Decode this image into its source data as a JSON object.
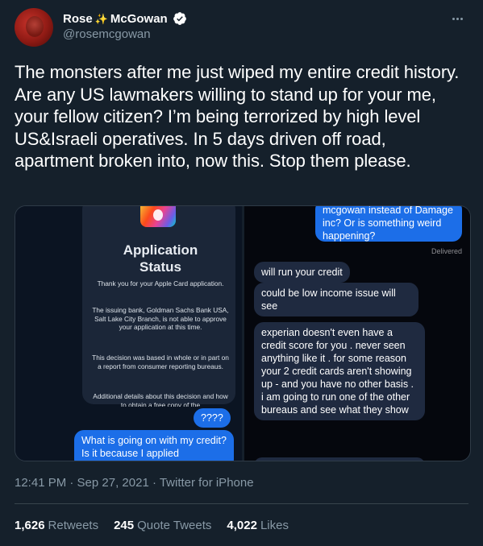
{
  "author": {
    "name_part1": "Rose",
    "name_part2": "McGowan",
    "sparkle": "✨",
    "handle": "@rosemcgowan",
    "verified": true
  },
  "tweet": {
    "text": "The monsters after me just wiped my entire credit history. Are any US lawmakers willing to stand up for your me, your fellow citizen? I’m being terrorized by high level US&Israeli operatives. In 5 days driven off road, apartment broken into, now this. Stop them please."
  },
  "media": {
    "left": {
      "title_line1": "Application",
      "title_line2": "Status",
      "para1": "Thank you for your Apple Card application.",
      "para2": "The issuing bank, Goldman Sachs Bank USA, Salt Lake City Branch, is not able to approve your application at this time.",
      "para3": "This decision was based in whole or in part on a report from consumer reporting bureaus.",
      "para4": "Additional details about this decision and how to obtain a free copy of the",
      "bubble_q": "????",
      "bubble_msg": "What is going on with my credit? Is it because I applied"
    },
    "right": {
      "top_bubble": "mcgowan instead of Damage inc? Or is something weird happening?",
      "delivered": "Delivered",
      "msg1": "will run your credit",
      "msg2": "could be low income issue will see",
      "msg3": "experian doesn't even have a credit score for you . never seen anything like it . for some reason your 2 credit cards aren't showing up - and you have no other basis . i am going to run one of the other bureaus and see what they show"
    }
  },
  "meta": {
    "timestamp": "12:41 PM · Sep 27, 2021 · Twitter for iPhone"
  },
  "stats": {
    "retweets_count": "1,626",
    "retweets_label": "Retweets",
    "quotes_count": "245",
    "quotes_label": "Quote Tweets",
    "likes_count": "4,022",
    "likes_label": "Likes"
  },
  "colors": {
    "background": "#15202b",
    "secondary_text": "#8899a6",
    "verified": "#1d9bf0",
    "imessage_blue": "#1c6ee8"
  }
}
